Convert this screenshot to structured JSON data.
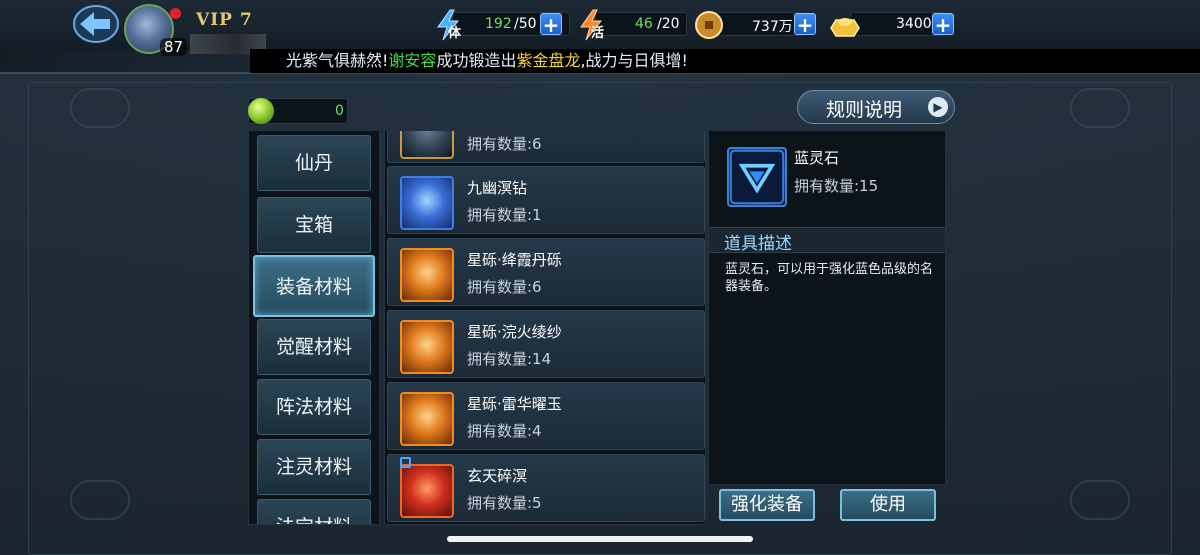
{
  "player": {
    "vip": "VIP 7",
    "level": "87"
  },
  "resources": {
    "stamina": {
      "label": "体",
      "value": "192",
      "max": "/50"
    },
    "vitality": {
      "label": "活",
      "value": "46",
      "max": "/20"
    },
    "coins": {
      "value": "737万"
    },
    "gold": {
      "value": "3400"
    },
    "plus": "+"
  },
  "marquee": {
    "prefix": "光紫气俱赫然!",
    "player": "谢安容",
    "middle": "成功锻造出",
    "item": "紫金盘龙",
    "suffix": ",战力与日俱增!"
  },
  "gem_counter": "0",
  "rules_button": "规则说明",
  "rules_arrow": "▶",
  "categories": [
    "仙丹",
    "宝箱",
    "装备材料",
    "觉醒材料",
    "阵法材料",
    "注灵材料",
    "法宝材料"
  ],
  "active_category": "装备材料",
  "items": [
    {
      "name": "",
      "count": "拥有数量:6"
    },
    {
      "name": "九幽溟钻",
      "count": "拥有数量:1"
    },
    {
      "name": "星砾·绛霞丹砾",
      "count": "拥有数量:6"
    },
    {
      "name": "星砾·浣火绫纱",
      "count": "拥有数量:14"
    },
    {
      "name": "星砾·雷华曜玉",
      "count": "拥有数量:4"
    },
    {
      "name": "玄天碎溟",
      "count": "拥有数量:5"
    }
  ],
  "detail": {
    "name": "蓝灵石",
    "count": "拥有数量:15",
    "section_title": "道具描述",
    "description": "蓝灵石，可以用于强化蓝色品级的名器装备。"
  },
  "buttons": {
    "enhance": "强化装备",
    "use": "使用"
  },
  "colors": {
    "accent": "#7cc0dc",
    "green_text": "#6fe05a",
    "highlight_yellow": "#f0d23a"
  }
}
